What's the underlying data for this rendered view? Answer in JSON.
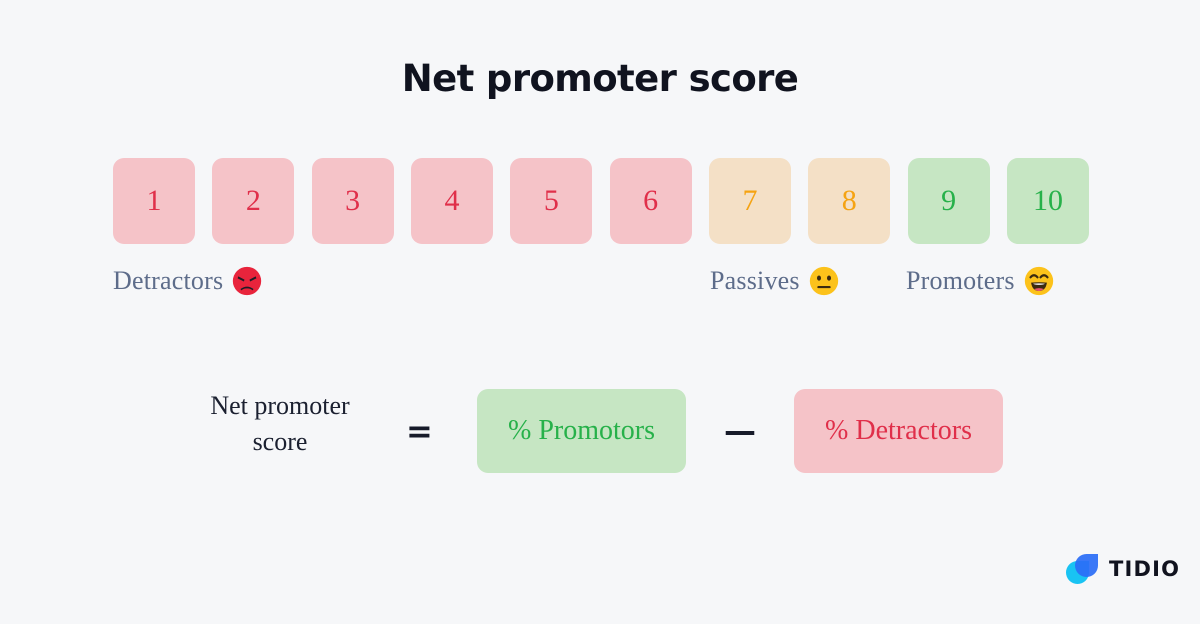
{
  "title": "Net promoter score",
  "colors": {
    "background": "#f6f7f9",
    "title": "#10131f",
    "detractor_bg": "#f5c3c8",
    "detractor_fg": "#e02f4a",
    "passive_bg": "#f4e0c6",
    "passive_fg": "#f5a312",
    "promoter_bg": "#c6e6c3",
    "promoter_fg": "#27b14a",
    "label_text": "#5d6c8a",
    "logo_cyan": "#19c3f3",
    "logo_blue": "#2b6ef6",
    "logo_word": "#11131f"
  },
  "scale": {
    "tiles": [
      {
        "value": "1",
        "segment": "detractor"
      },
      {
        "value": "2",
        "segment": "detractor"
      },
      {
        "value": "3",
        "segment": "detractor"
      },
      {
        "value": "4",
        "segment": "detractor"
      },
      {
        "value": "5",
        "segment": "detractor"
      },
      {
        "value": "6",
        "segment": "detractor"
      },
      {
        "value": "7",
        "segment": "passive"
      },
      {
        "value": "8",
        "segment": "passive"
      },
      {
        "value": "9",
        "segment": "promoter"
      },
      {
        "value": "10",
        "segment": "promoter"
      }
    ]
  },
  "segments": [
    {
      "label": "Detractors",
      "emoji_name": "angry-face-emoji",
      "range": "1-6"
    },
    {
      "label": "Passives",
      "emoji_name": "neutral-face-emoji",
      "range": "7-8"
    },
    {
      "label": "Promoters",
      "emoji_name": "grinning-face-emoji",
      "range": "9-10"
    }
  ],
  "formula": {
    "result_label": "Net promoter score",
    "result_line_1": "Net promoter",
    "result_line_2": "score",
    "equals": "=",
    "minus": "—",
    "promoters_term": "% Promotors",
    "detractors_term": "% Detractors"
  },
  "logo": {
    "wordmark": "TIDIO",
    "mark_name": "tidio-chat-bubbles-logo"
  }
}
